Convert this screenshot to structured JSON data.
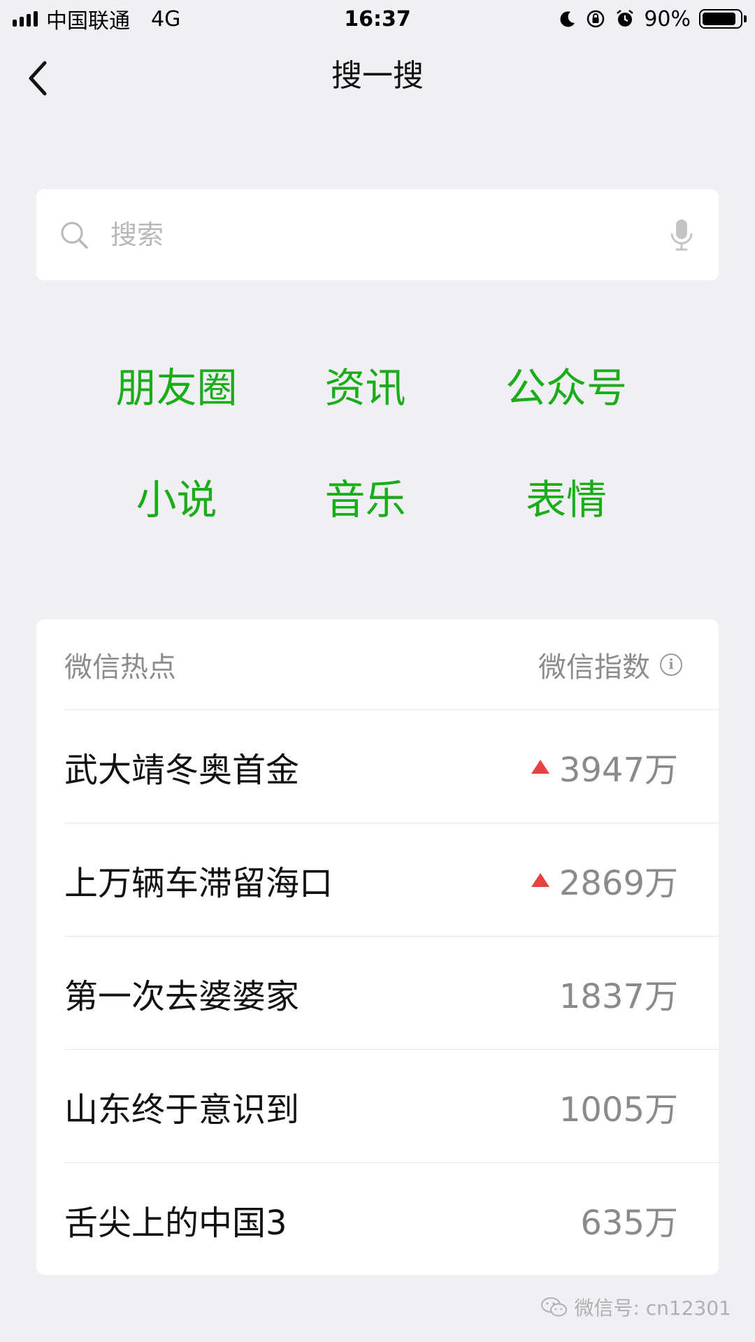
{
  "status_bar": {
    "carrier": "中国联通",
    "network": "4G",
    "time": "16:37",
    "battery": "90%",
    "battery_level": 0.9,
    "icons": [
      "signal-icon",
      "moon-icon",
      "rotation-lock-icon",
      "alarm-icon",
      "battery-icon"
    ]
  },
  "nav": {
    "back_icon": "chevron-left-icon",
    "title": "搜一搜"
  },
  "search": {
    "placeholder": "搜索",
    "search_icon": "search-icon",
    "voice_icon": "microphone-icon"
  },
  "categories": [
    [
      "朋友圈",
      "资讯",
      "公众号"
    ],
    [
      "小说",
      "音乐",
      "表情"
    ]
  ],
  "hot": {
    "title": "微信热点",
    "index_label": "微信指数",
    "info_icon": "info-icon",
    "items": [
      {
        "title": "武大靖冬奥首金",
        "index": "3947万",
        "trend": "up"
      },
      {
        "title": "上万辆车滞留海口",
        "index": "2869万",
        "trend": "up"
      },
      {
        "title": "第一次去婆婆家",
        "index": "1837万",
        "trend": ""
      },
      {
        "title": "山东终于意识到",
        "index": "1005万",
        "trend": ""
      },
      {
        "title": "舌尖上的中国3",
        "index": "635万",
        "trend": ""
      }
    ]
  },
  "watermark": {
    "text": "微信号: cn12301",
    "icon": "wechat-logo-icon"
  },
  "colors": {
    "accent_green": "#1aad19",
    "trend_red": "#e64340",
    "background": "#efeff4"
  }
}
